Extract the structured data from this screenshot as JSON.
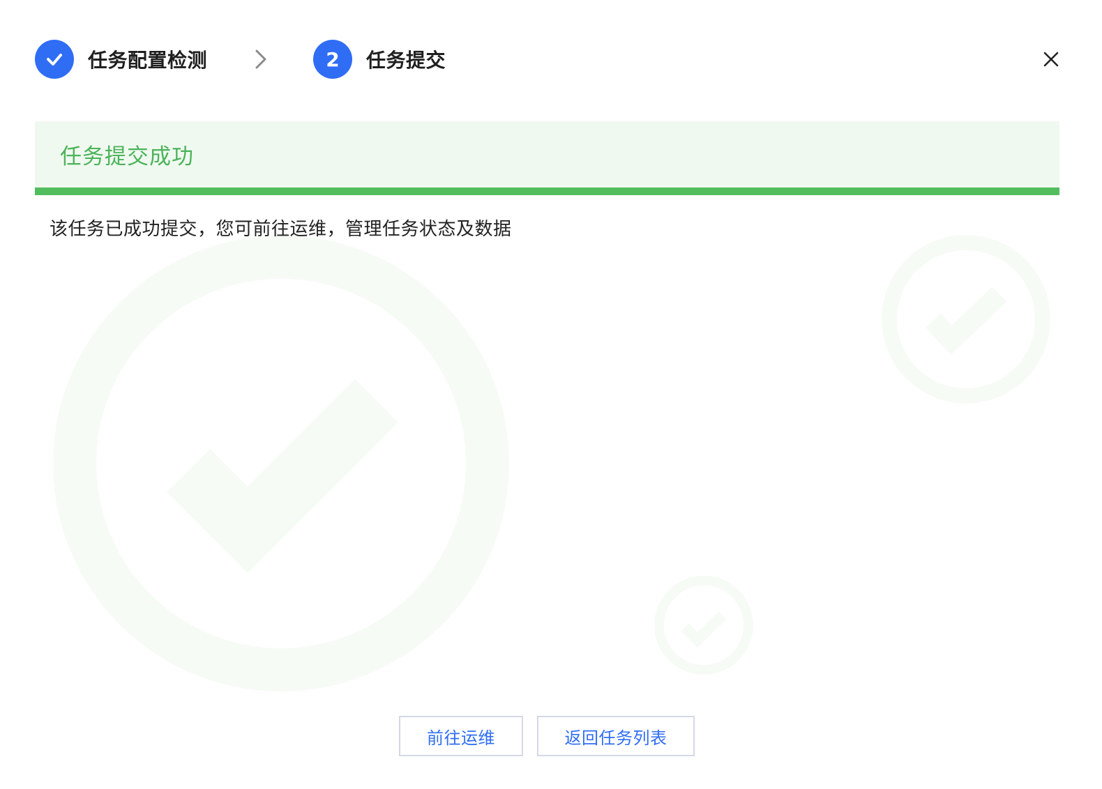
{
  "stepper": {
    "steps": [
      {
        "label": "任务配置检测",
        "state": "done",
        "icon": "check-icon"
      },
      {
        "label": "任务提交",
        "state": "active",
        "number": "2"
      }
    ],
    "separator_icon": "chevron-right-icon"
  },
  "close_icon": "close-icon",
  "banner": {
    "title": "任务提交成功"
  },
  "description": "该任务已成功提交，您可前往运维，管理任务状态及数据",
  "actions": {
    "ops_label": "前往运维",
    "back_label": "返回任务列表"
  },
  "colors": {
    "primary": "#2f6df5",
    "success_text": "#4bb35a",
    "success_bar": "#52bd5f",
    "success_bg": "#f0f9f0"
  }
}
